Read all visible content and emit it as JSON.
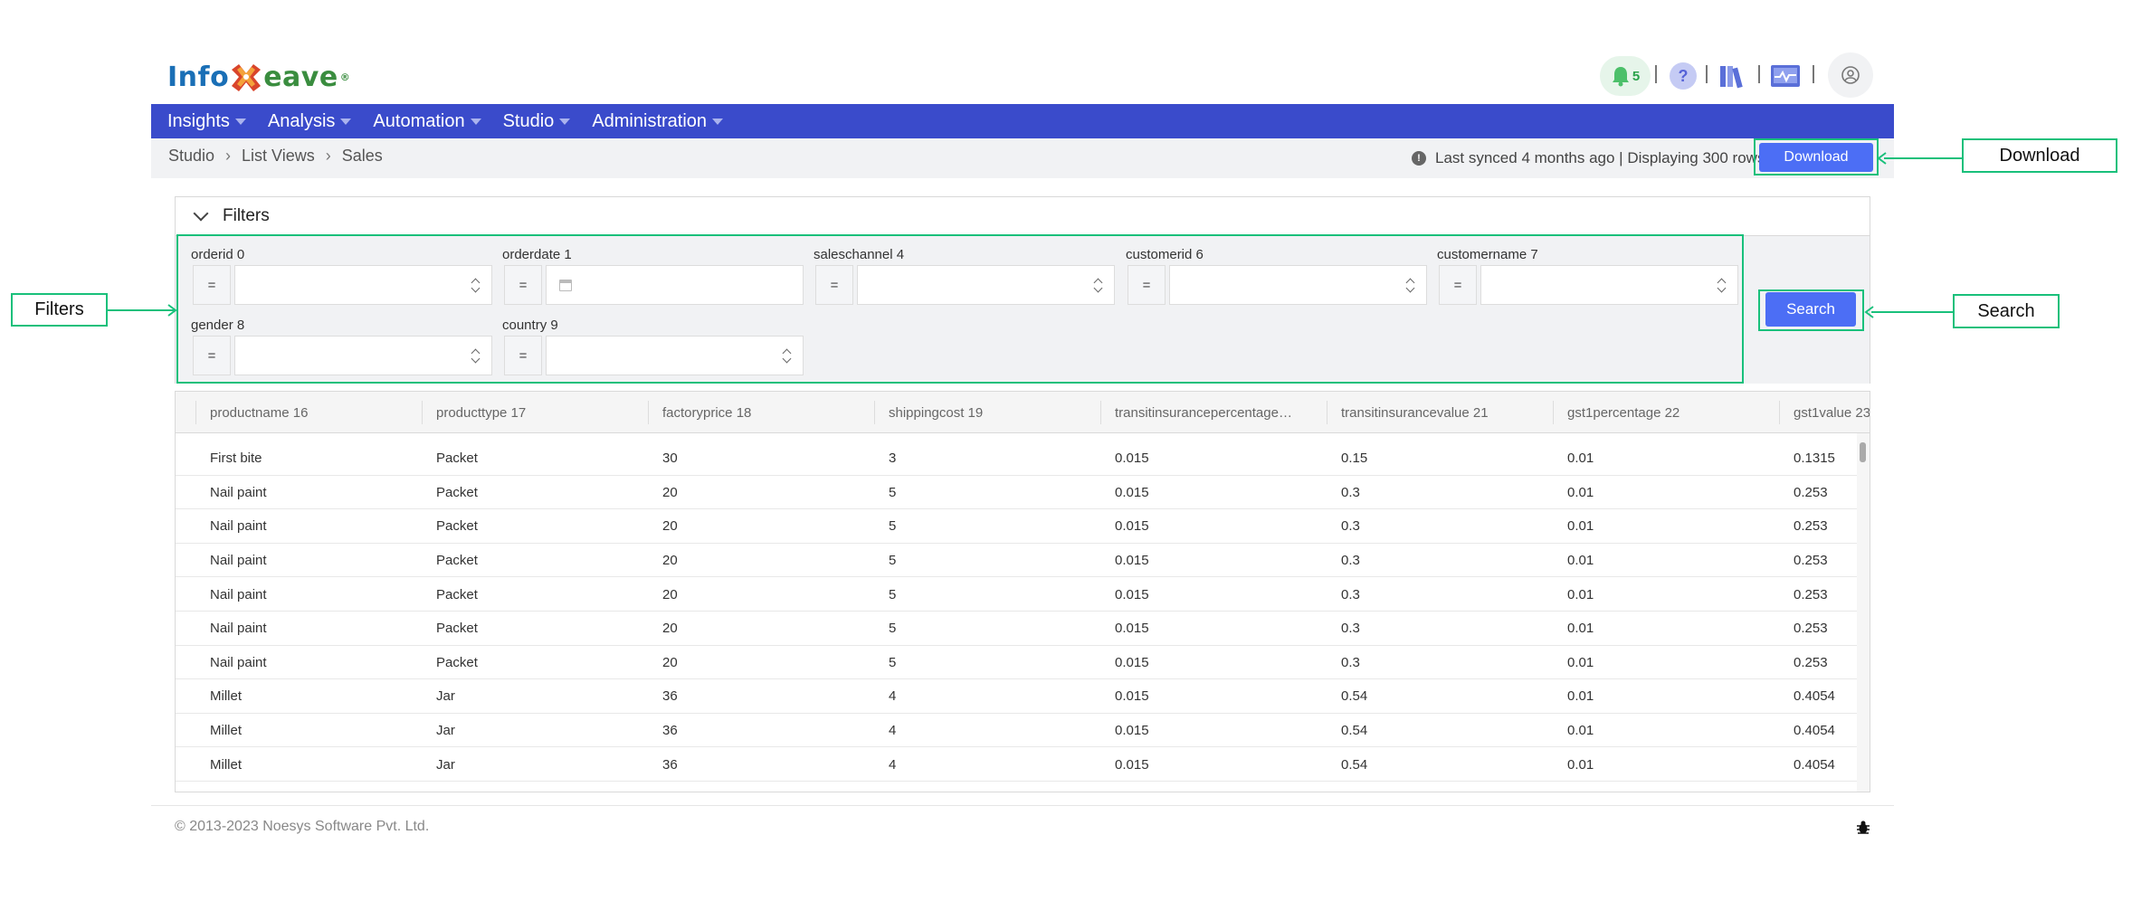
{
  "brand": {
    "part1": "Info",
    "part2": "eave",
    "registered": "®"
  },
  "topbar": {
    "notification_count": "5",
    "help_glyph": "?",
    "icons": [
      "bell-icon",
      "help-icon",
      "library-icon",
      "dashboard-icon",
      "user-icon"
    ]
  },
  "nav": {
    "items": [
      {
        "label": "Insights"
      },
      {
        "label": "Analysis"
      },
      {
        "label": "Automation"
      },
      {
        "label": "Studio"
      },
      {
        "label": "Administration"
      }
    ]
  },
  "breadcrumb": {
    "items": [
      "Studio",
      "List Views",
      "Sales"
    ]
  },
  "sync": {
    "text": "Last synced 4 months ago | Displaying 300 rows",
    "info_glyph": "!"
  },
  "download": {
    "label": "Download"
  },
  "annotations": {
    "download": "Download",
    "filters": "Filters",
    "search": "Search"
  },
  "filters": {
    "title": "Filters",
    "fields": [
      {
        "label": "orderid 0",
        "op": "="
      },
      {
        "label": "orderdate 1",
        "op": "="
      },
      {
        "label": "saleschannel 4",
        "op": "="
      },
      {
        "label": "customerid 6",
        "op": "="
      },
      {
        "label": "customername 7",
        "op": "="
      },
      {
        "label": "gender 8",
        "op": "="
      },
      {
        "label": "country 9",
        "op": "="
      }
    ],
    "search_label": "Search"
  },
  "table": {
    "columns": [
      "productname 16",
      "producttype 17",
      "factoryprice 18",
      "shippingcost 19",
      "transitinsurancepercentage…",
      "transitinsurancevalue 21",
      "gst1percentage 22",
      "gst1value 23"
    ],
    "rows": [
      [
        "First bite",
        "Packet",
        "30",
        "3",
        "0.015",
        "0.15",
        "0.01",
        "0.1315"
      ],
      [
        "Nail paint",
        "Packet",
        "20",
        "5",
        "0.015",
        "0.3",
        "0.01",
        "0.253"
      ],
      [
        "Nail paint",
        "Packet",
        "20",
        "5",
        "0.015",
        "0.3",
        "0.01",
        "0.253"
      ],
      [
        "Nail paint",
        "Packet",
        "20",
        "5",
        "0.015",
        "0.3",
        "0.01",
        "0.253"
      ],
      [
        "Nail paint",
        "Packet",
        "20",
        "5",
        "0.015",
        "0.3",
        "0.01",
        "0.253"
      ],
      [
        "Nail paint",
        "Packet",
        "20",
        "5",
        "0.015",
        "0.3",
        "0.01",
        "0.253"
      ],
      [
        "Nail paint",
        "Packet",
        "20",
        "5",
        "0.015",
        "0.3",
        "0.01",
        "0.253"
      ],
      [
        "Millet",
        "Jar",
        "36",
        "4",
        "0.015",
        "0.54",
        "0.01",
        "0.4054"
      ],
      [
        "Millet",
        "Jar",
        "36",
        "4",
        "0.015",
        "0.54",
        "0.01",
        "0.4054"
      ],
      [
        "Millet",
        "Jar",
        "36",
        "4",
        "0.015",
        "0.54",
        "0.01",
        "0.4054"
      ]
    ]
  },
  "footer": {
    "copyright": "© 2013-2023 Noesys Software Pvt. Ltd."
  },
  "colors": {
    "navbar": "#3a4bcb",
    "button": "#4c6ef5",
    "annotation": "#19c07b",
    "panel": "#f1f2f4"
  }
}
